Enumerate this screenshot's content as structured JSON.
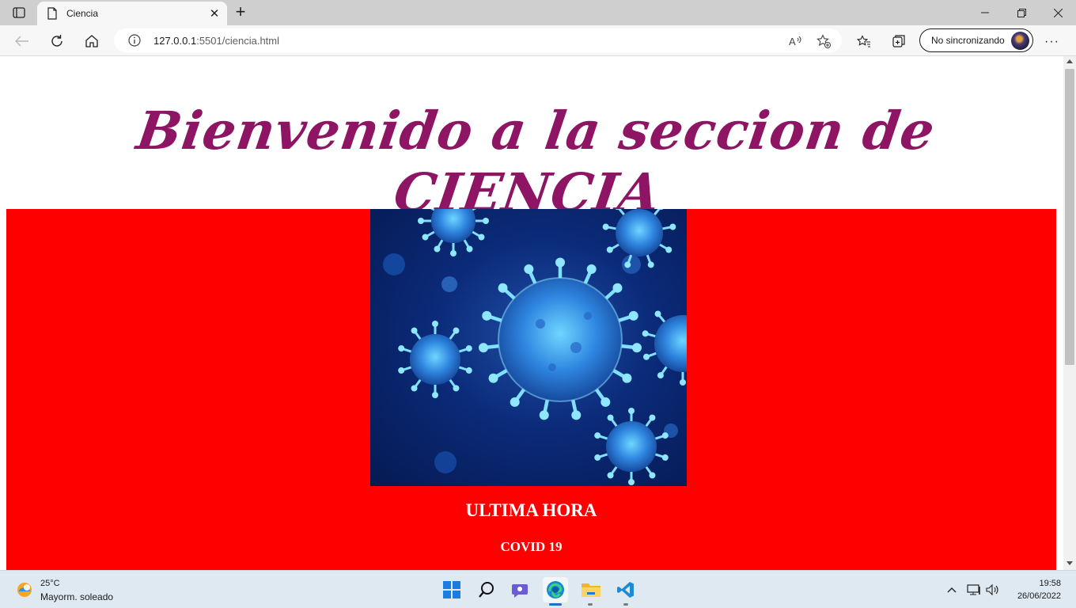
{
  "browser": {
    "tab": {
      "title": "Ciencia"
    },
    "address": {
      "host": "127.0.0.1",
      "rest": ":5501/ciencia.html"
    },
    "profile": {
      "label": "No sincronizando"
    }
  },
  "page": {
    "title": "Bienvenido a la seccion de CIENCIA",
    "section_heading": "ULTIMA HORA",
    "section_subheading": "COVID 19",
    "colors": {
      "title": "#8e1464",
      "section_background": "#ff0000",
      "section_text": "#ffffff"
    },
    "image": {
      "name": "coronavirus-image"
    }
  },
  "taskbar": {
    "weather": {
      "temperature": "25°C",
      "description": "Mayorm. soleado"
    },
    "clock": {
      "time": "19:58",
      "date": "26/06/2022"
    }
  }
}
